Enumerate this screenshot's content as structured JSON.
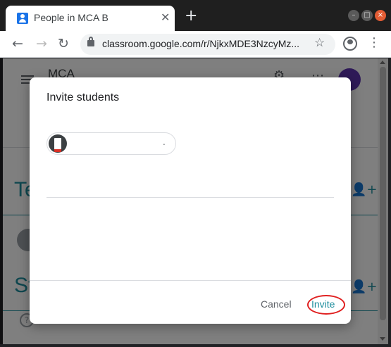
{
  "browser": {
    "tab_title": "People in MCA B",
    "tab_close": "✕",
    "new_tab": "+",
    "url": "classroom.google.com/r/NjkxMDE3NzcyMz...",
    "window_controls": {
      "minimize": "–",
      "maximize": "□",
      "close": "×"
    }
  },
  "page": {
    "class_name": "MCA",
    "teachers_heading": "Te",
    "students_heading": "St",
    "help": "?"
  },
  "dialog": {
    "title": "Invite students",
    "chip_name": "",
    "chip_suffix": ".",
    "cancel_label": "Cancel",
    "invite_label": "Invite"
  },
  "colors": {
    "accent": "#1e8e9e",
    "highlight": "#e02020",
    "user_avatar": "#5e35b1"
  },
  "icons": [
    "classroom-favicon-icon",
    "back-arrow-icon",
    "forward-arrow-icon",
    "reload-icon",
    "lock-icon",
    "star-icon",
    "profile-icon",
    "kebab-menu-icon",
    "hamburger-icon",
    "gear-icon",
    "apps-icon",
    "add-person-icon",
    "help-icon"
  ]
}
